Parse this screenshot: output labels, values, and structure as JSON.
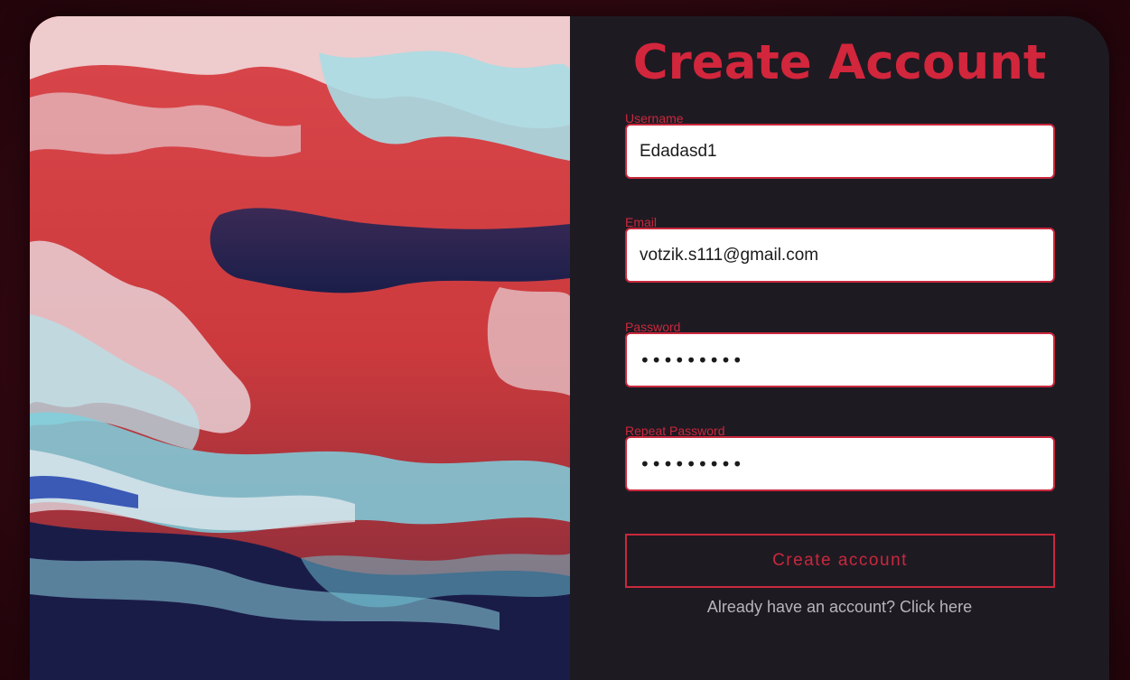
{
  "form": {
    "title": "Create Account",
    "username": {
      "label": "Username",
      "value": "Edadasd1"
    },
    "email": {
      "label": "Email",
      "value": "votzik.s111@gmail.com"
    },
    "password": {
      "label": "Password",
      "value": "•••••••••"
    },
    "repeat_password": {
      "label": "Repeat Password",
      "value": "•••••••••"
    },
    "submit_label": "Create account",
    "login_link": "Already have an account? Click here"
  },
  "colors": {
    "accent": "#c9283d",
    "card_bg": "#1e1a22",
    "page_bg": "#3a0a12",
    "link_text": "#b8b4bc"
  }
}
